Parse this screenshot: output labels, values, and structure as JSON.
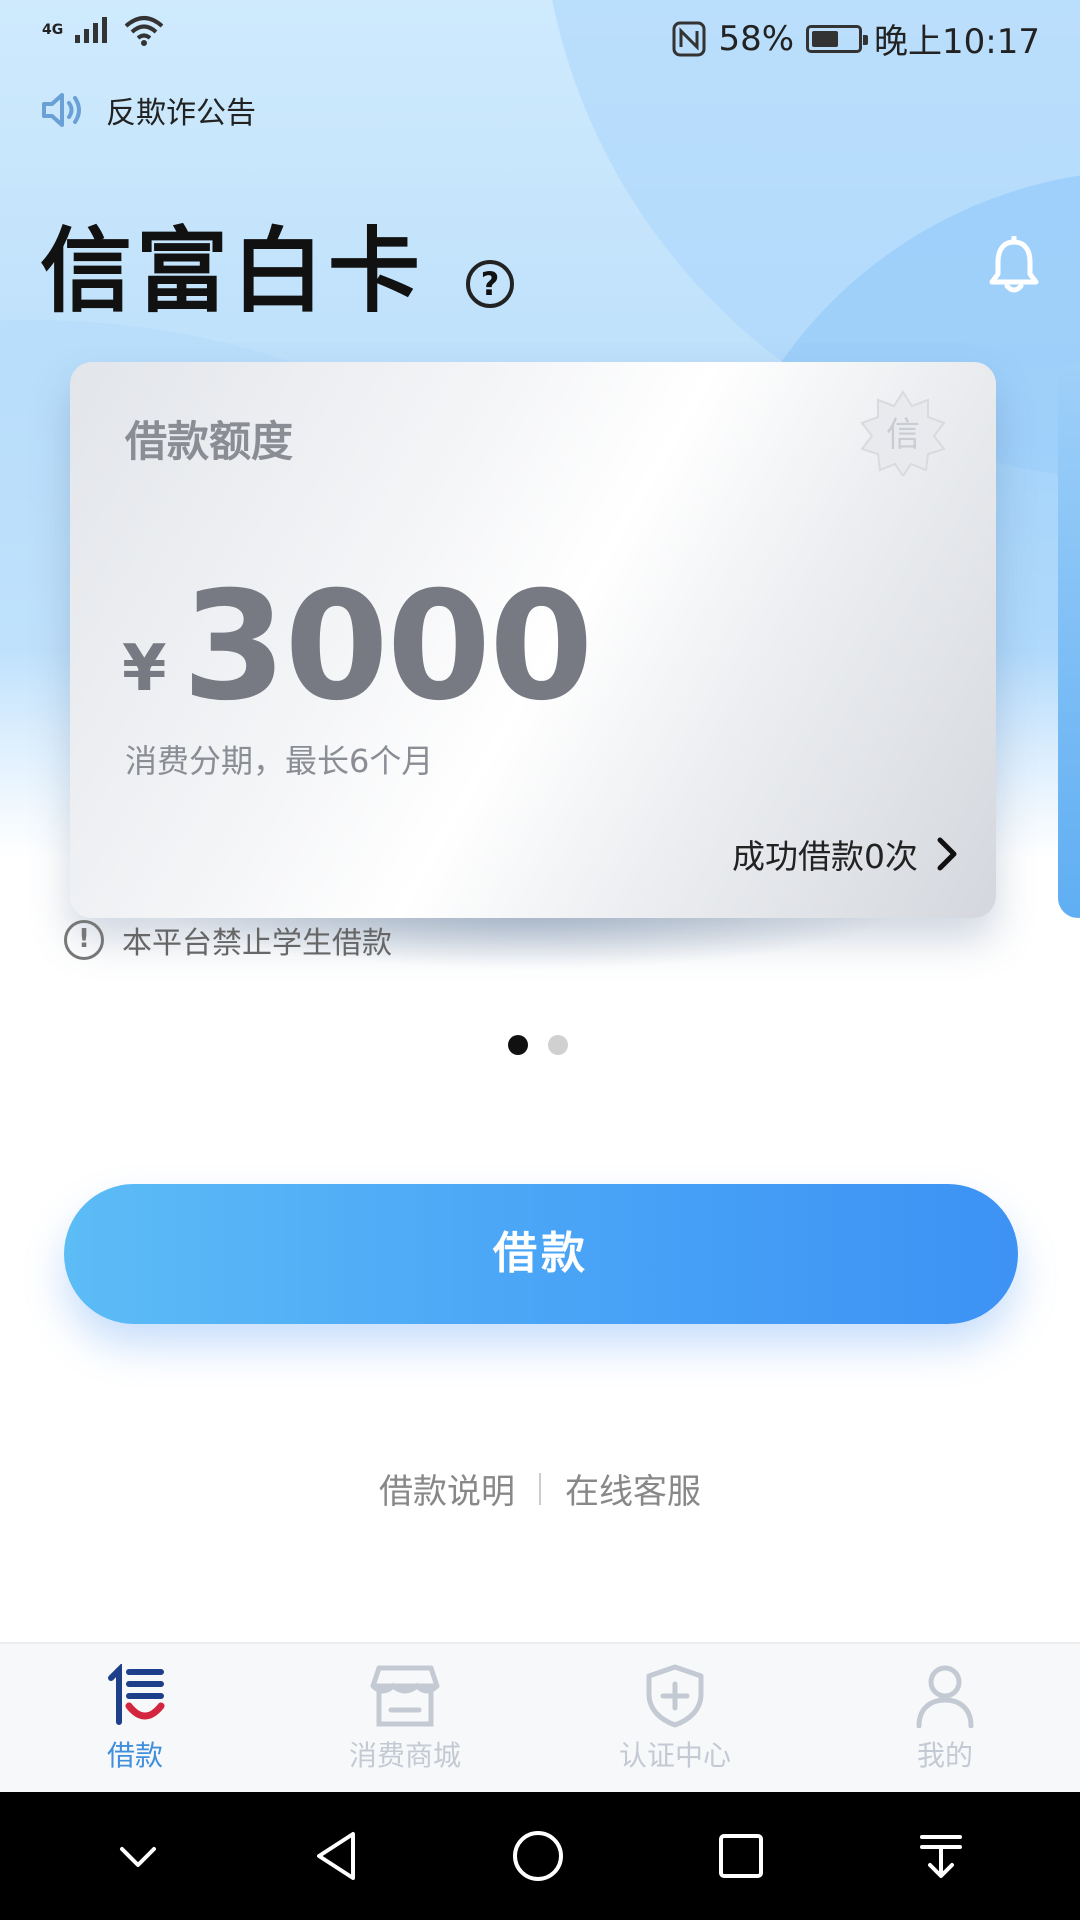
{
  "status_bar": {
    "network": "4G",
    "battery_percent": "58%",
    "battery_level": 0.58,
    "time": "晚上10:17"
  },
  "notice": {
    "text": "反欺诈公告"
  },
  "header": {
    "title": "信富白卡",
    "help_symbol": "?"
  },
  "card": {
    "label": "借款额度",
    "currency": "¥",
    "amount": "3000",
    "subtitle": "消费分期，最长6个月",
    "success_text": "成功借款0次",
    "badge_char": "信"
  },
  "warning": {
    "symbol": "!",
    "text": "本平台禁止学生借款"
  },
  "pager": {
    "count": 2,
    "active": 0
  },
  "loan_button": {
    "label": "借款"
  },
  "footer_links": [
    {
      "label": "借款说明"
    },
    {
      "label": "在线客服"
    }
  ],
  "tabs": [
    {
      "label": "借款",
      "icon": "xin-logo-icon",
      "active": true
    },
    {
      "label": "消费商城",
      "icon": "store-icon",
      "active": false
    },
    {
      "label": "认证中心",
      "icon": "shield-plus-icon",
      "active": false
    },
    {
      "label": "我的",
      "icon": "user-icon",
      "active": false
    }
  ],
  "colors": {
    "accent": "#4aa5f6",
    "tab_active": "#3f8fdc",
    "tab_inactive": "#c4cad3",
    "card_text": "#777a82"
  }
}
